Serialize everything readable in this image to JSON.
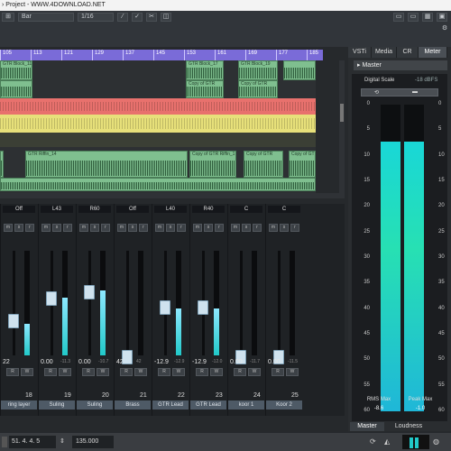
{
  "window_title": "› Project - WWW.4DOWNLOAD.NET",
  "toolbar": {
    "grid_type": "Bar",
    "quantize": "1/16"
  },
  "ruler": {
    "ticks": [
      "105",
      "113",
      "121",
      "129",
      "137",
      "145",
      "153",
      "161",
      "169",
      "177",
      "185"
    ]
  },
  "tracks": {
    "clip_labels": [
      "GTR Block_11",
      "GTR Block_17",
      "GTR Block_19",
      "Copy of GTR",
      "Copy of GTR",
      "GTR Riffin_14",
      "Copy of GTR Riffin_1",
      "Copy of GTR",
      "Copy of GTR",
      "Copy of GTR Riff"
    ]
  },
  "mixer": {
    "strips": [
      {
        "top": "Off",
        "value": "22",
        "peak": "",
        "number": "",
        "name": "ring layer",
        "level": 0.3
      },
      {
        "top": "L43",
        "value": "0.00",
        "peak": "-11.3",
        "number": "19",
        "name": "Suling",
        "level": 0.55
      },
      {
        "top": "R60",
        "value": "0.00",
        "peak": "-10.7",
        "number": "20",
        "name": "Suling",
        "level": 0.62
      },
      {
        "top": "Off",
        "value": "42",
        "peak": "42",
        "number": "21",
        "name": "Brass",
        "level": 0.0
      },
      {
        "top": "L40",
        "value": "-12.9",
        "peak": "-12.9",
        "number": "22",
        "name": "GTR Lead",
        "level": 0.45
      },
      {
        "top": "R40",
        "value": "-12.9",
        "peak": "-12.0",
        "number": "23",
        "name": "GTR Lead",
        "level": 0.45
      },
      {
        "top": "C",
        "value": "0.00",
        "peak": "-11.7",
        "number": "24",
        "name": "koor 1",
        "level": 0.0
      },
      {
        "top": "C",
        "value": "0.00",
        "peak": "-11.5",
        "number": "25",
        "name": "Koor 2",
        "level": 0.0
      }
    ],
    "first_number": "18"
  },
  "right_zone": {
    "tabs": [
      "VSTi",
      "Media",
      "CR",
      "Meter"
    ],
    "master_label": "Master",
    "digital_scale_label": "Digital Scale",
    "digital_scale_value": "-18 dBFS",
    "scale_left": [
      "0",
      "5",
      "10",
      "15",
      "20",
      "25",
      "30",
      "35",
      "40",
      "45",
      "50",
      "55",
      "60"
    ],
    "scale_right": [
      "0",
      "5",
      "10",
      "15",
      "20",
      "25",
      "30",
      "35",
      "40",
      "45",
      "50",
      "55",
      "60"
    ],
    "rms_label": "RMS Max",
    "rms_value": "-8.6",
    "peak_label": "Peak Max",
    "peak_value": "-1.0",
    "bottom_tabs": [
      "Master",
      "Loudness"
    ],
    "meter_levels": [
      0.88,
      0.88
    ]
  },
  "transport": {
    "position": "51. 4. 4. 5",
    "tempo": "135.000"
  },
  "colors": {
    "ruler": "#7a6bd8",
    "clip_green": "#7fbf8f",
    "lane_red": "#e8716d",
    "lane_yellow": "#e7e07a",
    "meter": "#21c9c9"
  }
}
